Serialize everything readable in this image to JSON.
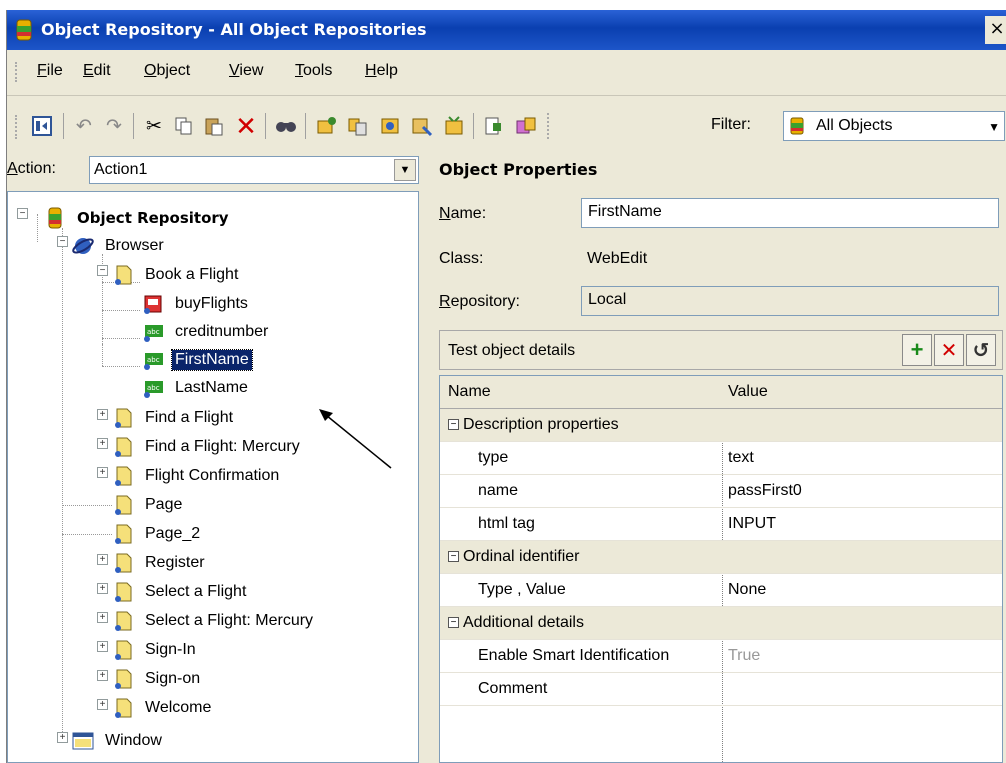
{
  "window": {
    "title": "Object Repository - All Object Repositories",
    "close_glyph": "×"
  },
  "menu": [
    {
      "label": "File",
      "key": "F"
    },
    {
      "label": "Edit",
      "key": "E"
    },
    {
      "label": "Object",
      "key": "O"
    },
    {
      "label": "View",
      "key": "V"
    },
    {
      "label": "Tools",
      "key": "T"
    },
    {
      "label": "Help",
      "key": "H"
    }
  ],
  "toolbar": {
    "filter_label": "Filter:",
    "filter_value": "All Objects",
    "icons": [
      "properties-icon",
      "undo-icon",
      "redo-icon",
      "cut-icon",
      "copy-icon",
      "paste-icon",
      "delete-icon",
      "find-icon",
      "add-object-icon",
      "add-objects-icon",
      "object-spy-icon",
      "highlight-icon",
      "navigate-icon",
      "locate-icon",
      "merge-icon"
    ]
  },
  "action": {
    "label": "Action:",
    "value": "Action1"
  },
  "tree": {
    "root": "Object Repository",
    "browser": "Browser",
    "book_a_flight": "Book a Flight",
    "children": [
      "buyFlights",
      "creditnumber",
      "FirstName",
      "LastName"
    ],
    "pages": [
      "Find a Flight",
      "Find a Flight: Mercury",
      "Flight Confirmation",
      "Page",
      "Page_2",
      "Register",
      "Select a Flight",
      "Select a Flight: Mercury",
      "Sign-In",
      "Sign-on",
      "Welcome"
    ],
    "window": "Window",
    "selected": "FirstName"
  },
  "properties": {
    "title": "Object Properties",
    "name_label": "Name:",
    "name_value": "FirstName",
    "class_label": "Class:",
    "class_value": "WebEdit",
    "repository_label": "Repository:",
    "repository_value": "Local"
  },
  "details": {
    "label": "Test object details",
    "columns": [
      "Name",
      "Value"
    ],
    "rows": [
      {
        "type": "group",
        "name": "Description properties",
        "value": ""
      },
      {
        "type": "row",
        "name": "type",
        "value": "text"
      },
      {
        "type": "row",
        "name": "name",
        "value": "passFirst0"
      },
      {
        "type": "row",
        "name": "html tag",
        "value": "INPUT"
      },
      {
        "type": "group",
        "name": "Ordinal identifier",
        "value": ""
      },
      {
        "type": "row",
        "name": "Type , Value",
        "value": "None"
      },
      {
        "type": "group",
        "name": "Additional details",
        "value": ""
      },
      {
        "type": "row",
        "name": "Enable Smart Identification",
        "value": "True"
      },
      {
        "type": "row",
        "name": "Comment",
        "value": ""
      }
    ]
  },
  "colors": {
    "title_bar": "#0a3fb0",
    "selection": "#0a246a",
    "chrome": "#ece9d8"
  }
}
